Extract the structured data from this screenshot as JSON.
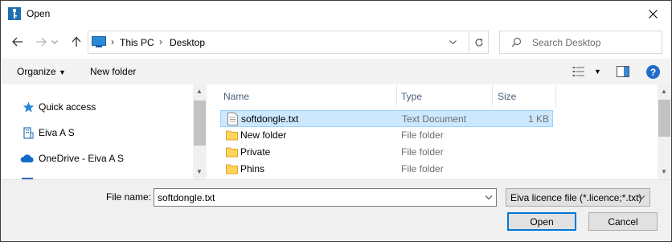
{
  "window": {
    "title": "Open"
  },
  "address": {
    "crumbs": [
      "This PC",
      "Desktop"
    ]
  },
  "search": {
    "placeholder": "Search Desktop"
  },
  "toolbar": {
    "organize": "Organize",
    "new_folder": "New folder"
  },
  "nav": {
    "items": [
      {
        "label": "Quick access",
        "icon": "star-icon"
      },
      {
        "label": "Eiva A S",
        "icon": "building-icon"
      },
      {
        "label": "OneDrive - Eiva A S",
        "icon": "cloud-icon"
      }
    ]
  },
  "columns": {
    "name": "Name",
    "type": "Type",
    "size": "Size"
  },
  "files": [
    {
      "name": "softdongle.txt",
      "type": "Text Document",
      "size": "1 KB",
      "icon": "text-file-icon",
      "selected": true
    },
    {
      "name": "New folder",
      "type": "File folder",
      "size": "",
      "icon": "folder-icon"
    },
    {
      "name": "Private",
      "type": "File folder",
      "size": "",
      "icon": "folder-icon"
    },
    {
      "name": "Phins",
      "type": "File folder",
      "size": "",
      "icon": "folder-icon"
    }
  ],
  "bottom": {
    "file_name_label": "File name:",
    "file_name_value": "softdongle.txt",
    "filter": "Eiva licence file (*.licence;*.txt)",
    "open_label": "Open",
    "cancel_label": "Cancel"
  },
  "colors": {
    "accent": "#0078d7",
    "selection": "#cce8ff",
    "folder": "#ffd35c"
  }
}
